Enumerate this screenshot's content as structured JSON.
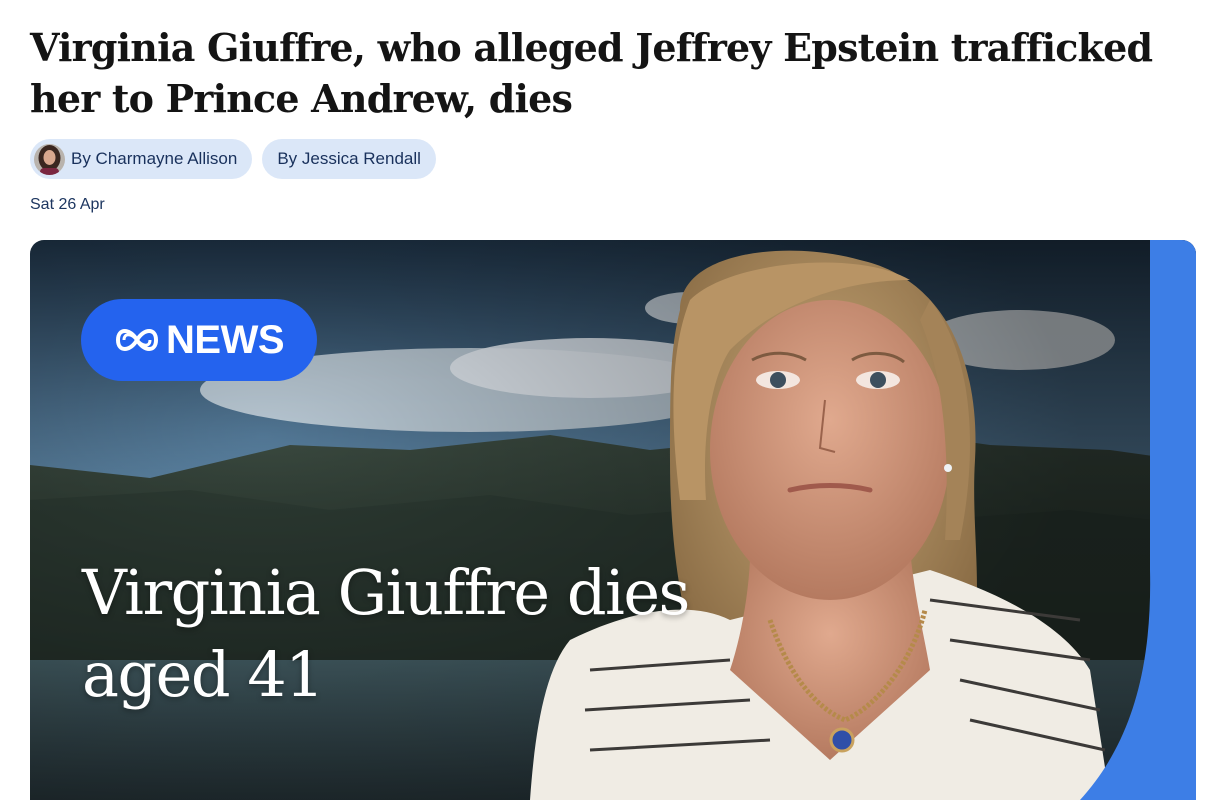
{
  "headline": "Virginia Giuffre, who alleged Jeffrey Epstein trafficked her to Prince Andrew, dies",
  "authors": [
    {
      "label": "By Charmayne Allison",
      "avatar": "author-photo"
    },
    {
      "label": "By Jessica Rendall"
    }
  ],
  "date": "Sat 26 Apr",
  "hero_image": {
    "logo_text": "NEWS",
    "overlay_title": "Virginia Giuffre dies aged 41"
  },
  "colors": {
    "pill_bg": "#dbe7f8",
    "pill_text": "#19315c",
    "abc_blue": "#2463ee",
    "frame_blue": "#3d7ee6"
  }
}
